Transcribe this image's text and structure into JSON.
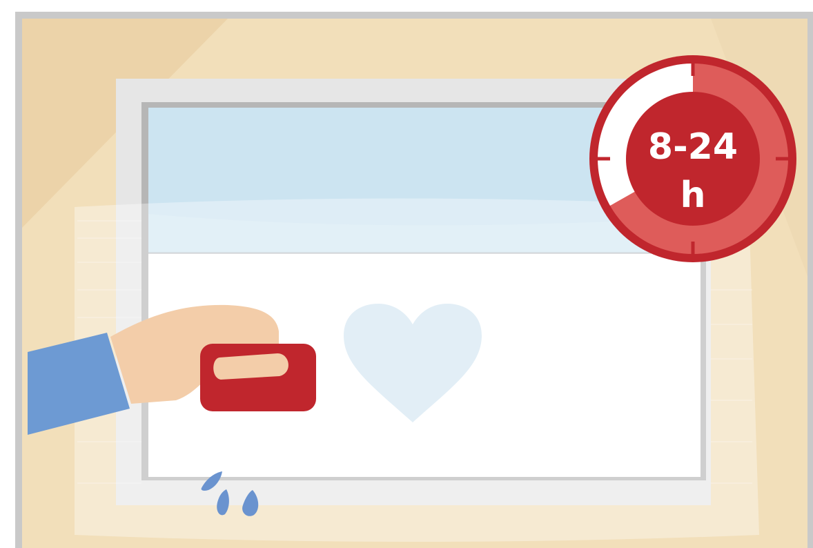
{
  "timer": {
    "range_label": "8-24",
    "unit_label": "h"
  },
  "colors": {
    "wall": "#f2dfba",
    "wall_shadow": "#ebd2a8",
    "frame_outer": "#c9c9c9",
    "window_frame": "#e6e6e6",
    "glass_blue": "#cce4f1",
    "film_white": "#ffffff",
    "heart": "#e2eef6",
    "squeegee_red": "#c0262d",
    "timer_red_dark": "#c0262d",
    "timer_red_light": "#de5c5a",
    "sleeve_blue": "#6d9ad3",
    "skin": "#f3cda9",
    "water_drops": "#6a93cf"
  },
  "icons": [
    "timer-icon",
    "heart-icon",
    "water-drops-icon",
    "hand-icon",
    "squeegee-icon"
  ]
}
